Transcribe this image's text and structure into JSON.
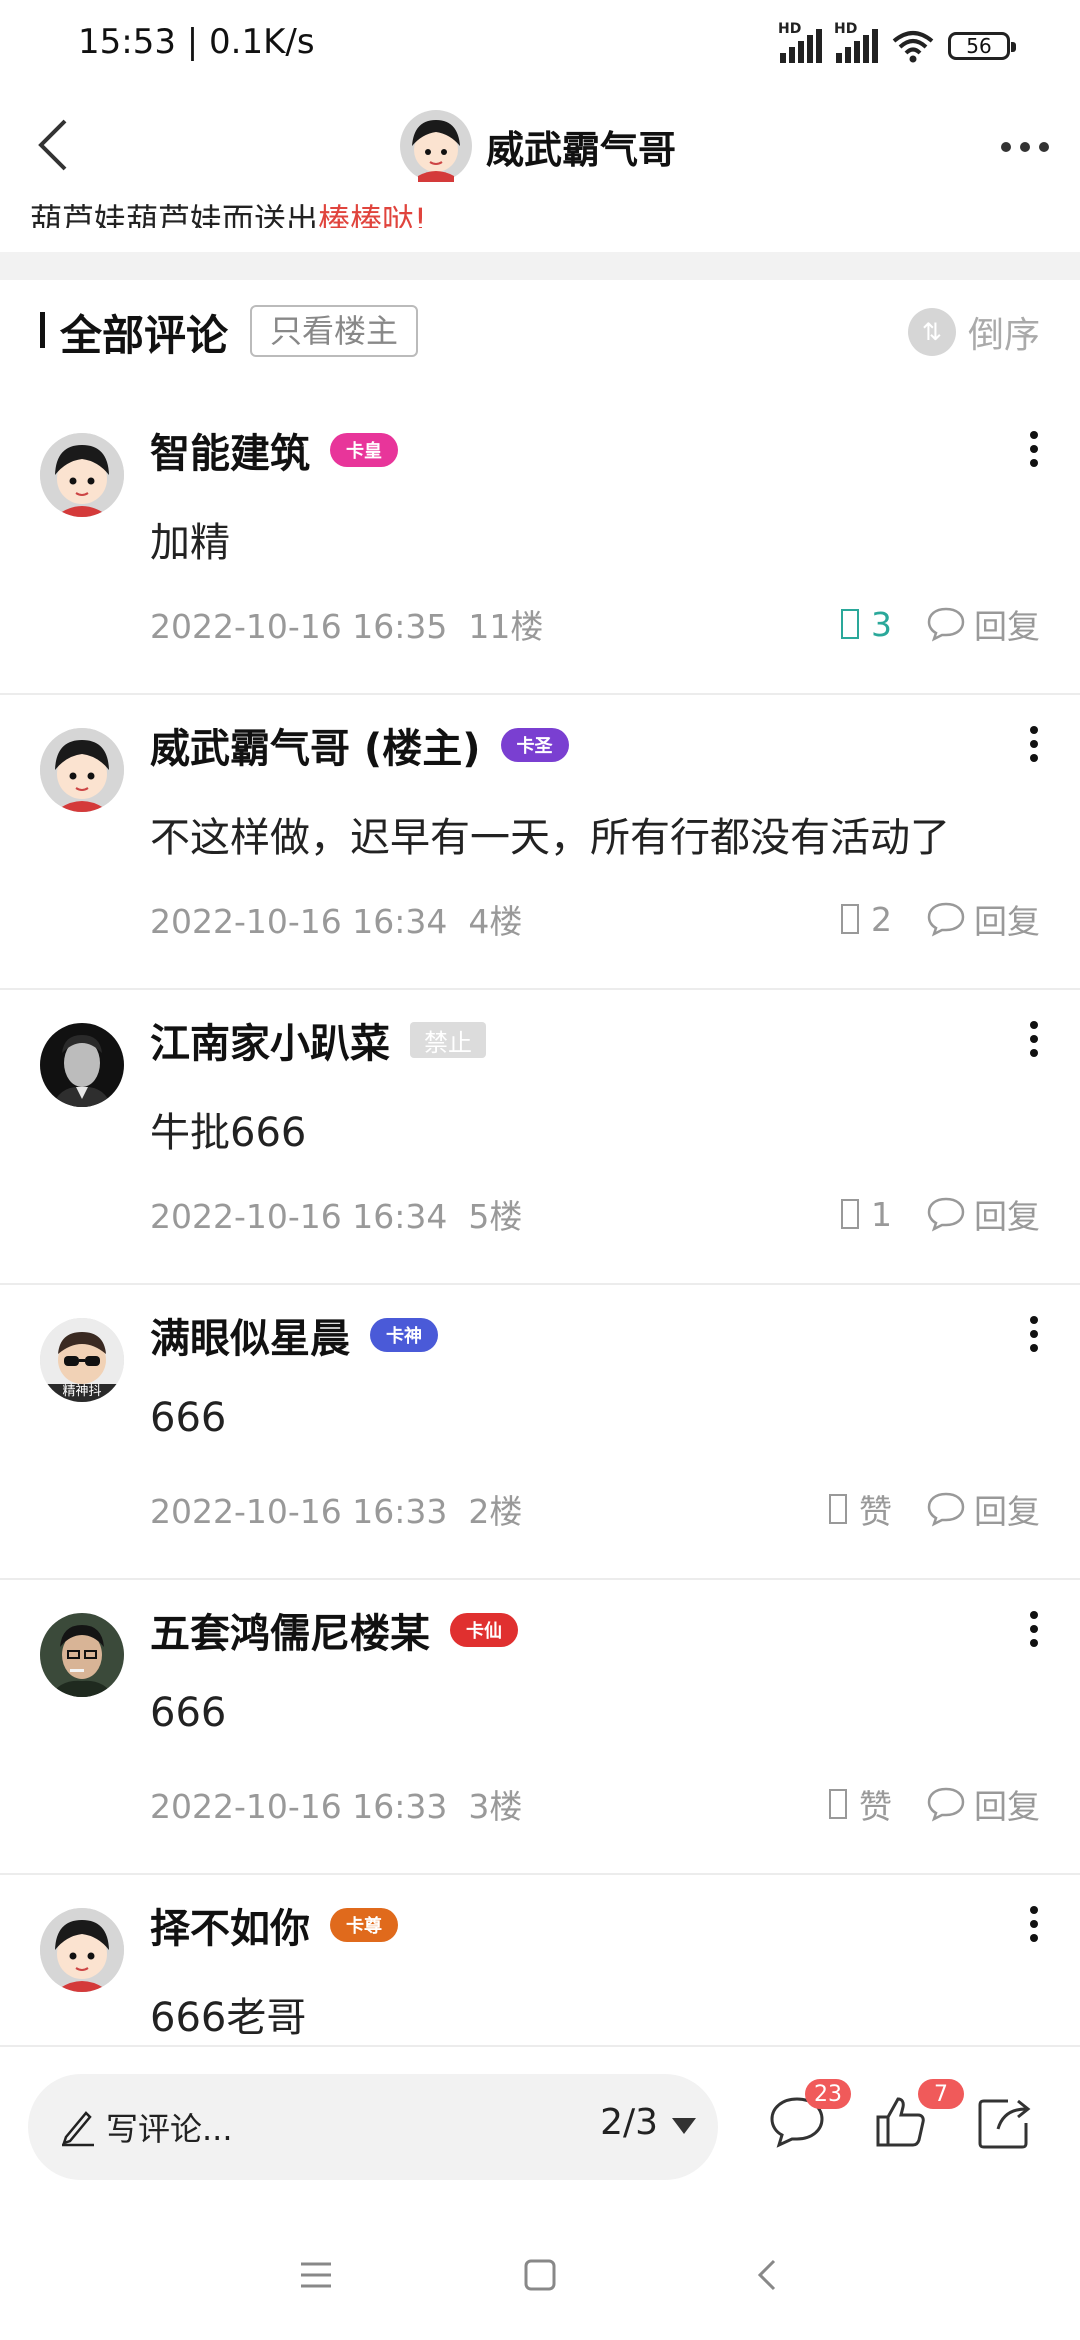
{
  "status_bar": {
    "time": "15:53 | 0.1K/s",
    "signal_tag": "HD",
    "battery": "56"
  },
  "title_bar": {
    "title": "威武霸气哥"
  },
  "post_excerpt": {
    "text": "葫芦娃葫芦娃而送出",
    "highlight": "棒棒哒!"
  },
  "comments_header": {
    "title": "全部评论",
    "only_owner": "只看楼主",
    "sort_label": "倒序"
  },
  "comments": [
    {
      "user": "智能建筑",
      "badge": "卡皇",
      "badge_color": "#e8359a",
      "text": "加精",
      "time": "2022-10-16 16:35",
      "floor": "11楼",
      "likes": "3",
      "liked": true,
      "reply": "回复",
      "avatar": "cartoon"
    },
    {
      "user": "威武霸气哥 (楼主)",
      "badge": "卡圣",
      "badge_color": "#7a3fd1",
      "text": "不这样做，迟早有一天，所有行都没有活动了",
      "time": "2022-10-16 16:34",
      "floor": "4楼",
      "likes": "2",
      "liked": false,
      "reply": "回复",
      "avatar": "cartoon"
    },
    {
      "user": "江南家小趴菜",
      "badge": "禁止",
      "badge_color": "#dcdcdc",
      "text": "牛批666",
      "time": "2022-10-16 16:34",
      "floor": "5楼",
      "likes": "1",
      "liked": false,
      "reply": "回复",
      "avatar": "photo-bw"
    },
    {
      "user": "满眼似星晨",
      "badge": "卡神",
      "badge_color": "#4a5ad8",
      "text": "666",
      "time": "2022-10-16 16:33",
      "floor": "2楼",
      "likes": "赞",
      "liked": false,
      "reply": "回复",
      "avatar": "photo-kid",
      "avatar_text": "精神抖"
    },
    {
      "user": "五套鸿儒尼楼某",
      "badge": "卡仙",
      "badge_color": "#e0302f",
      "text": "666",
      "time": "2022-10-16 16:33",
      "floor": "3楼",
      "likes": "赞",
      "liked": false,
      "reply": "回复",
      "avatar": "photo-man"
    },
    {
      "user": "择不如你",
      "badge": "卡尊",
      "badge_color": "#e06a1c",
      "text": "666老哥",
      "time": "",
      "floor": "",
      "likes": "",
      "liked": false,
      "reply": "",
      "avatar": "cartoon"
    }
  ],
  "bottom_bar": {
    "placeholder": "写评论...",
    "page": "2/3",
    "comment_count": "23",
    "like_count": "7"
  }
}
